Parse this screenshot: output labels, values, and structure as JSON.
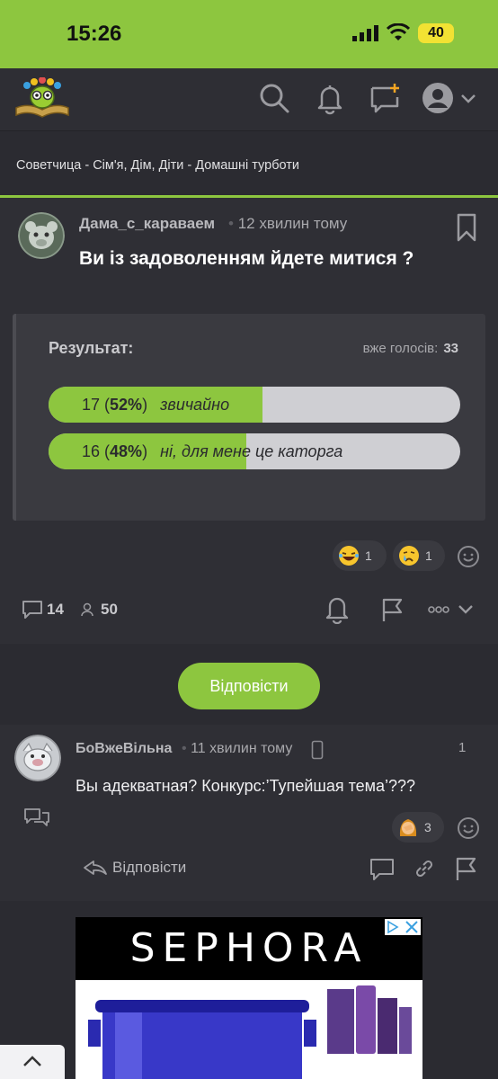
{
  "status_bar": {
    "time": "15:26",
    "battery": "40"
  },
  "nav": {
    "icons": [
      "search-icon",
      "bell-icon",
      "new-topic-icon",
      "user-avatar-icon",
      "chevron-down-icon"
    ]
  },
  "breadcrumb": "Советчица - Сім'я, Дім, Діти - Домашні турботи",
  "post": {
    "author": "Дама_с_караваем",
    "time": "12 хвилин тому",
    "title": "Ви із задоволенням йдете митися ?",
    "poll": {
      "heading": "Результат:",
      "votes_label": "вже голосів:",
      "votes_total": "33",
      "options": [
        {
          "count": "17",
          "percent": "52%",
          "label": "звичайно",
          "fraction": 0.52
        },
        {
          "count": "16",
          "percent": "48%",
          "label": "ні, для мене це каторга",
          "fraction": 0.48
        }
      ]
    },
    "reactions": [
      {
        "emoji": "laughing-emoji",
        "count": "1"
      },
      {
        "emoji": "crying-emoji",
        "count": "1"
      }
    ],
    "stats": {
      "comments": "14",
      "participants": "50"
    }
  },
  "reply_button": "Відповісти",
  "comment": {
    "author": "БоВжеВільна",
    "time": "11 хвилин тому",
    "number": "1",
    "text": "Вы адекватная? Конкурс:’Тупейшая тема’???",
    "reactions": [
      {
        "emoji": "facepalm-emoji",
        "count": "3"
      }
    ],
    "reply_label": "Відповісти"
  },
  "ad": {
    "brand": "SEPHORA"
  },
  "colors": {
    "accent": "#8dc63f",
    "background": "#2b2b31",
    "card": "#2f2f35"
  }
}
